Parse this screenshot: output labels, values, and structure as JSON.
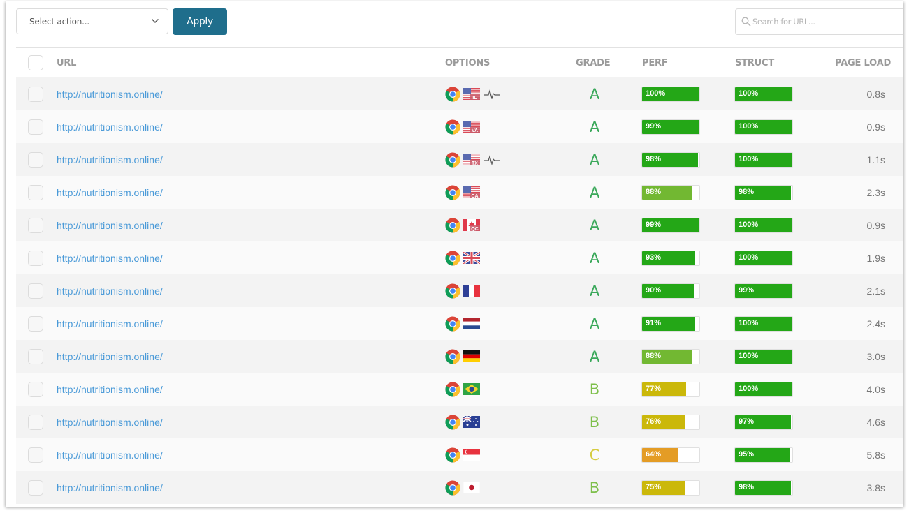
{
  "toolbar": {
    "select_placeholder": "Select action...",
    "apply_label": "Apply",
    "search_placeholder": "Search for URL..."
  },
  "columns": {
    "url": "URL",
    "options": "OPTIONS",
    "grade": "GRADE",
    "perf": "PERF",
    "struct": "STRUCT",
    "page_load": "PAGE LOAD"
  },
  "colors": {
    "accent": "#1f6e8c",
    "link": "#4a9ad8",
    "bar_green": "#24a717",
    "bar_lightgreen": "#72b832",
    "bar_yellow": "#cbb80a",
    "bar_orange": "#e49c25",
    "grade_A": "#3aa85a",
    "grade_B": "#7dbf4a",
    "grade_C": "#d6cc40"
  },
  "rows": [
    {
      "url": "http://nutritionism.online/",
      "browser": "chrome-icon",
      "flag": "us",
      "region": "IL",
      "monitor": true,
      "grade": "A",
      "perf": 100,
      "perf_label": "100%",
      "struct": 100,
      "struct_label": "100%",
      "page_load": "0.8s"
    },
    {
      "url": "http://nutritionism.online/",
      "browser": "chrome-icon",
      "flag": "us",
      "region": "VA",
      "monitor": false,
      "grade": "A",
      "perf": 99,
      "perf_label": "99%",
      "struct": 100,
      "struct_label": "100%",
      "page_load": "0.9s"
    },
    {
      "url": "http://nutritionism.online/",
      "browser": "chrome-icon",
      "flag": "us",
      "region": "TX",
      "monitor": true,
      "grade": "A",
      "perf": 98,
      "perf_label": "98%",
      "struct": 100,
      "struct_label": "100%",
      "page_load": "1.1s"
    },
    {
      "url": "http://nutritionism.online/",
      "browser": "chrome-icon",
      "flag": "us",
      "region": "CA",
      "monitor": false,
      "grade": "A",
      "perf": 88,
      "perf_label": "88%",
      "struct": 98,
      "struct_label": "98%",
      "page_load": "2.3s"
    },
    {
      "url": "http://nutritionism.online/",
      "browser": "chrome-icon",
      "flag": "ca",
      "region": "QC",
      "monitor": false,
      "grade": "A",
      "perf": 99,
      "perf_label": "99%",
      "struct": 100,
      "struct_label": "100%",
      "page_load": "0.9s"
    },
    {
      "url": "http://nutritionism.online/",
      "browser": "chrome-icon",
      "flag": "gb",
      "region": "",
      "monitor": false,
      "grade": "A",
      "perf": 93,
      "perf_label": "93%",
      "struct": 100,
      "struct_label": "100%",
      "page_load": "1.9s"
    },
    {
      "url": "http://nutritionism.online/",
      "browser": "chrome-icon",
      "flag": "fr",
      "region": "",
      "monitor": false,
      "grade": "A",
      "perf": 90,
      "perf_label": "90%",
      "struct": 99,
      "struct_label": "99%",
      "page_load": "2.1s"
    },
    {
      "url": "http://nutritionism.online/",
      "browser": "chrome-icon",
      "flag": "nl",
      "region": "",
      "monitor": false,
      "grade": "A",
      "perf": 91,
      "perf_label": "91%",
      "struct": 100,
      "struct_label": "100%",
      "page_load": "2.4s"
    },
    {
      "url": "http://nutritionism.online/",
      "browser": "chrome-icon",
      "flag": "de",
      "region": "",
      "monitor": false,
      "grade": "A",
      "perf": 88,
      "perf_label": "88%",
      "struct": 100,
      "struct_label": "100%",
      "page_load": "3.0s"
    },
    {
      "url": "http://nutritionism.online/",
      "browser": "chrome-icon",
      "flag": "br",
      "region": "",
      "monitor": false,
      "grade": "B",
      "perf": 77,
      "perf_label": "77%",
      "struct": 100,
      "struct_label": "100%",
      "page_load": "4.0s"
    },
    {
      "url": "http://nutritionism.online/",
      "browser": "chrome-icon",
      "flag": "au",
      "region": "",
      "monitor": false,
      "grade": "B",
      "perf": 76,
      "perf_label": "76%",
      "struct": 97,
      "struct_label": "97%",
      "page_load": "4.6s"
    },
    {
      "url": "http://nutritionism.online/",
      "browser": "chrome-icon",
      "flag": "sg",
      "region": "",
      "monitor": false,
      "grade": "C",
      "perf": 64,
      "perf_label": "64%",
      "struct": 95,
      "struct_label": "95%",
      "page_load": "5.8s"
    },
    {
      "url": "http://nutritionism.online/",
      "browser": "chrome-icon",
      "flag": "jp",
      "region": "",
      "monitor": false,
      "grade": "B",
      "perf": 75,
      "perf_label": "75%",
      "struct": 98,
      "struct_label": "98%",
      "page_load": "3.8s"
    }
  ]
}
